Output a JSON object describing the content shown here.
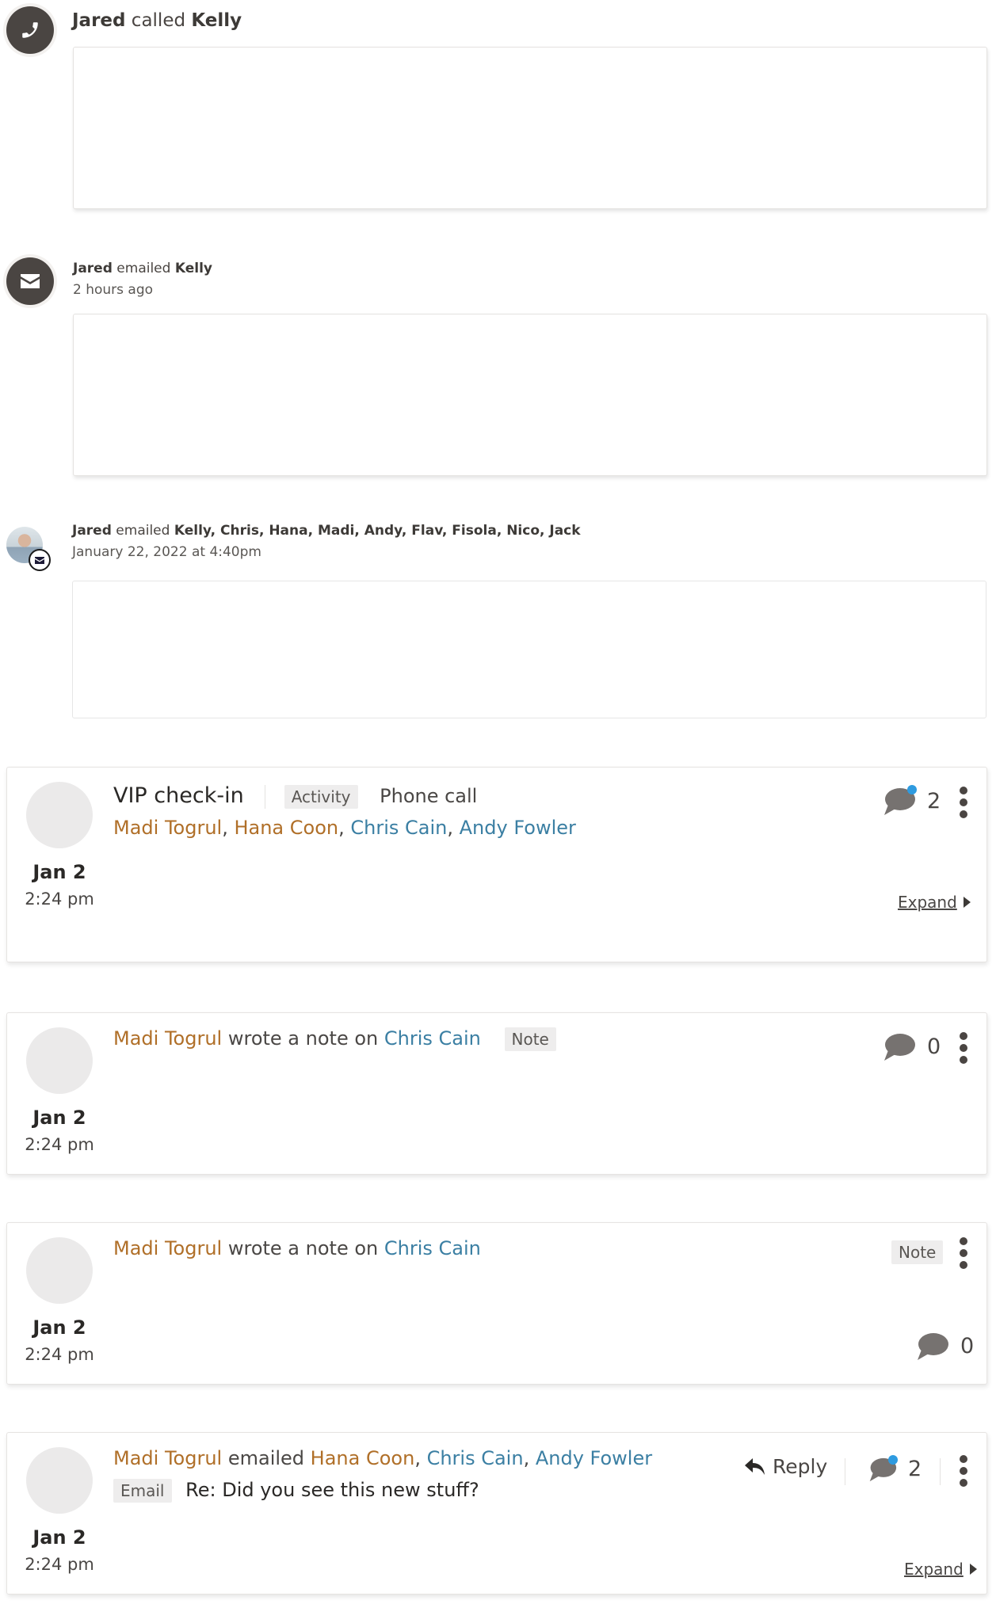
{
  "timeline": [
    {
      "icon": "phone-icon",
      "actor": "Jared",
      "verb": "called",
      "target": "Kelly",
      "meta": ""
    },
    {
      "icon": "envelope-icon",
      "actor": "Jared",
      "verb": "emailed",
      "target": "Kelly",
      "meta": "2 hours ago"
    },
    {
      "icon": "user-photo-with-envelope-badge",
      "actor": "Jared",
      "verb": "emailed",
      "target": "Kelly, Chris, Hana, Madi, Andy, Flav, Fisola, Nico, Jack",
      "meta": "January 22, 2022 at 4:40pm"
    }
  ],
  "cards": [
    {
      "type": "activity",
      "title": "VIP check-in",
      "tag": "Activity",
      "subtype": "Phone call",
      "people": [
        {
          "name": "Madi Togrul",
          "kind": "user"
        },
        {
          "name": "Hana Coon",
          "kind": "user"
        },
        {
          "name": "Chris Cain",
          "kind": "contact"
        },
        {
          "name": "Andy Fowler",
          "kind": "contact"
        }
      ],
      "comment_count": "2",
      "has_unread_comment": true,
      "expand_label": "Expand",
      "date": "Jan 2",
      "time": "2:24 pm"
    },
    {
      "type": "note",
      "author": "Madi Togrul",
      "verb": "wrote a note on",
      "subject": "Chris Cain",
      "tag": "Note",
      "comment_count": "0",
      "has_unread_comment": false,
      "date": "Jan 2",
      "time": "2:24 pm"
    },
    {
      "type": "note",
      "author": "Madi Togrul",
      "verb": "wrote a note on",
      "subject": "Chris Cain",
      "tag": "Note",
      "comment_count": "0",
      "has_unread_comment": false,
      "date": "Jan 2",
      "time": "2:24 pm"
    },
    {
      "type": "email",
      "author": "Madi Togrul",
      "verb": "emailed",
      "recipients": [
        {
          "name": "Hana Coon",
          "kind": "user"
        },
        {
          "name": "Chris Cain",
          "kind": "contact"
        },
        {
          "name": "Andy Fowler",
          "kind": "contact"
        }
      ],
      "tag": "Email",
      "subject_line": "Re: Did you see this new stuff?",
      "reply_label": "Reply",
      "comment_count": "2",
      "has_unread_comment": true,
      "expand_label": "Expand",
      "date": "Jan 2",
      "time": "2:24 pm"
    }
  ],
  "colors": {
    "user_name": "#b06f28",
    "contact_name": "#3b7fa3",
    "icon_bg": "#4a4542",
    "unread_dot": "#2e9be0",
    "tag_bg": "#eeeded"
  },
  "sep": ", "
}
